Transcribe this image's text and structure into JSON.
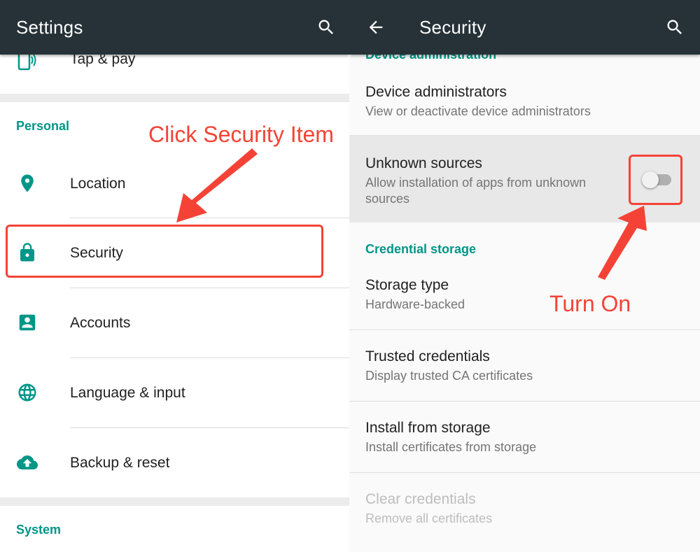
{
  "left": {
    "appbar": {
      "title": "Settings",
      "search_icon": "search-icon"
    },
    "top_item": {
      "label": "Tap & pay",
      "icon": "tap-pay-icon"
    },
    "personal": {
      "header": "Personal",
      "items": [
        {
          "label": "Location",
          "icon": "location-pin-icon"
        },
        {
          "label": "Security",
          "icon": "lock-icon"
        },
        {
          "label": "Accounts",
          "icon": "account-box-icon"
        },
        {
          "label": "Language & input",
          "icon": "globe-icon"
        },
        {
          "label": "Backup & reset",
          "icon": "cloud-upload-icon"
        }
      ]
    },
    "system": {
      "header": "System"
    }
  },
  "right": {
    "appbar": {
      "title": "Security",
      "back_icon": "arrow-back-icon",
      "search_icon": "search-icon"
    },
    "device_admin": {
      "header": "Device administration",
      "items": [
        {
          "title": "Device administrators",
          "subtitle": "View or deactivate device administrators"
        },
        {
          "title": "Unknown sources",
          "subtitle_line1": "Allow installation of apps from unknown",
          "subtitle_line2": "sources",
          "toggle_on": false
        }
      ]
    },
    "credential_storage": {
      "header": "Credential storage",
      "items": [
        {
          "title": "Storage type",
          "subtitle": "Hardware-backed"
        },
        {
          "title": "Trusted credentials",
          "subtitle": "Display trusted CA certificates"
        },
        {
          "title": "Install from storage",
          "subtitle": "Install certificates from storage"
        },
        {
          "title": "Clear credentials",
          "subtitle": "Remove all certificates",
          "disabled": true
        }
      ]
    }
  },
  "annotations": {
    "click_security": "Click Security Item",
    "turn_on": "Turn On",
    "color": "#f44336"
  },
  "colors": {
    "appbar": "#263238",
    "accent": "#009688",
    "highlight": "#e8e8e8"
  }
}
